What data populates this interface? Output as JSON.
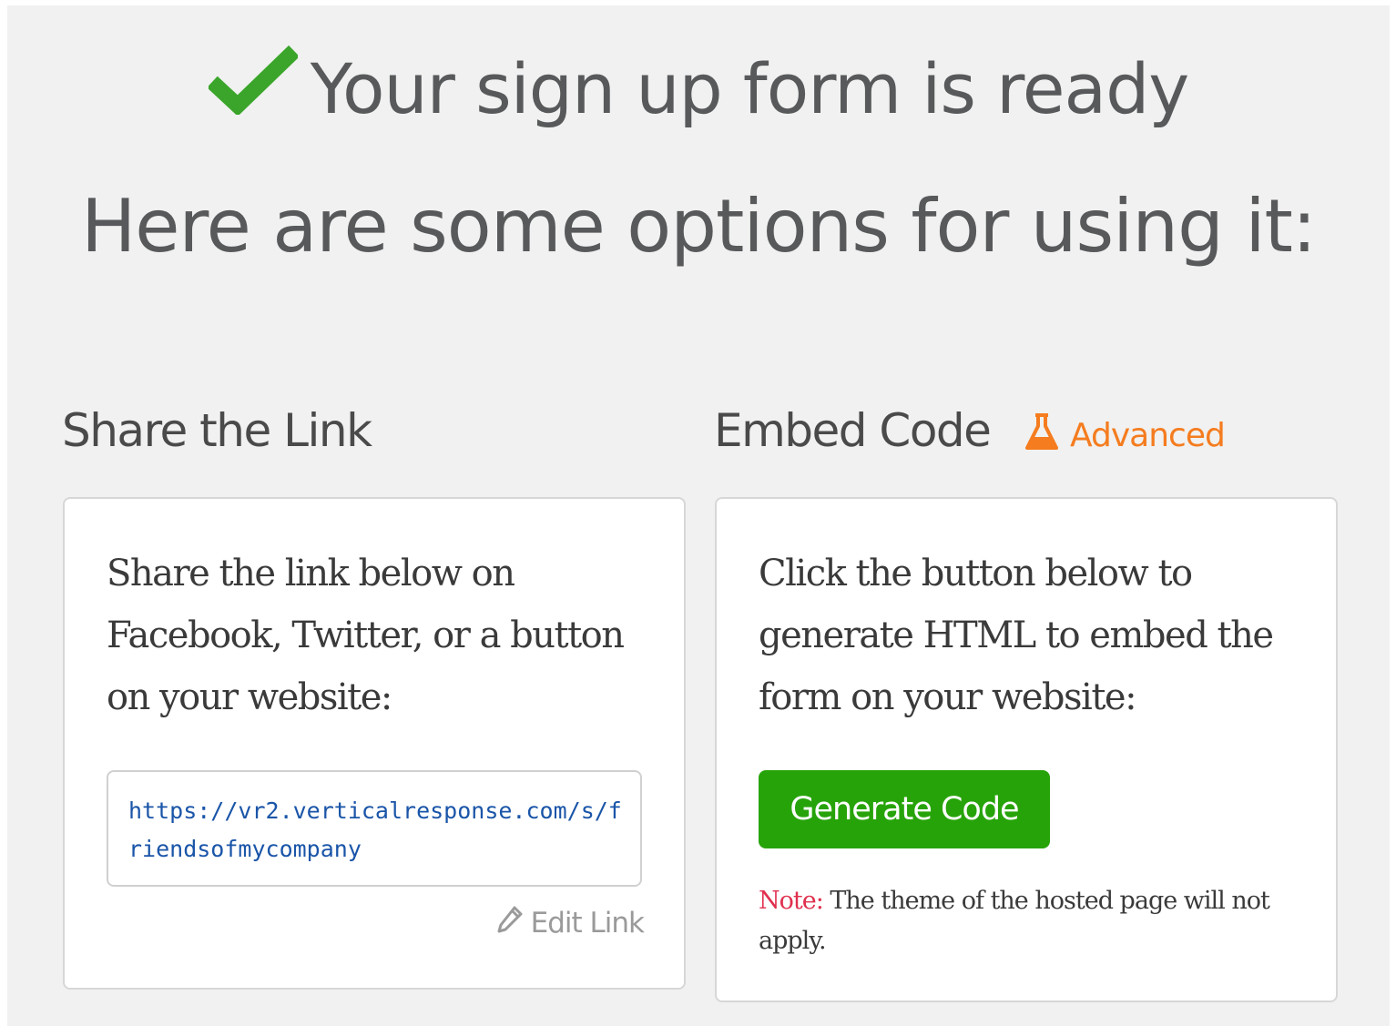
{
  "header": {
    "title": "Your sign up form is ready",
    "subtitle": "Here are some options for using it:",
    "check_icon": "checkmark-icon",
    "check_color": "#3aa52a"
  },
  "share": {
    "title": "Share the Link",
    "description": "Share the link below on Facebook, Twitter, or a button on your website:",
    "url": "https://vr2.verticalresponse.com/s/friendsofmycompany",
    "edit_label": "Edit Link",
    "edit_icon": "pencil-icon"
  },
  "embed": {
    "title": "Embed Code",
    "advanced_label": "Advanced",
    "advanced_icon": "flask-icon",
    "advanced_color": "#f57c1f",
    "description": "Click the button below to generate HTML to embed the form on your website:",
    "button_label": "Generate Code",
    "button_color": "#27a30a",
    "note_label": "Note:",
    "note_text": " The theme of the hosted page will not apply."
  }
}
